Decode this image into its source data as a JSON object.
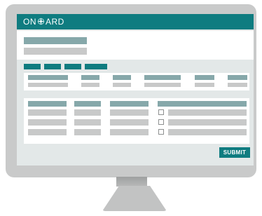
{
  "app": {
    "brand_prefix": "ON",
    "brand_suffix": "ARD",
    "brand_icon": "compass-icon"
  },
  "actions": {
    "submit_label": "SUBMIT"
  },
  "colors": {
    "accent": "#0f7c80",
    "header_cell": "#86a8aa",
    "placeholder": "#c8c9c9",
    "screen_bg": "#e3e8e8",
    "bezel": "#c9caca"
  }
}
